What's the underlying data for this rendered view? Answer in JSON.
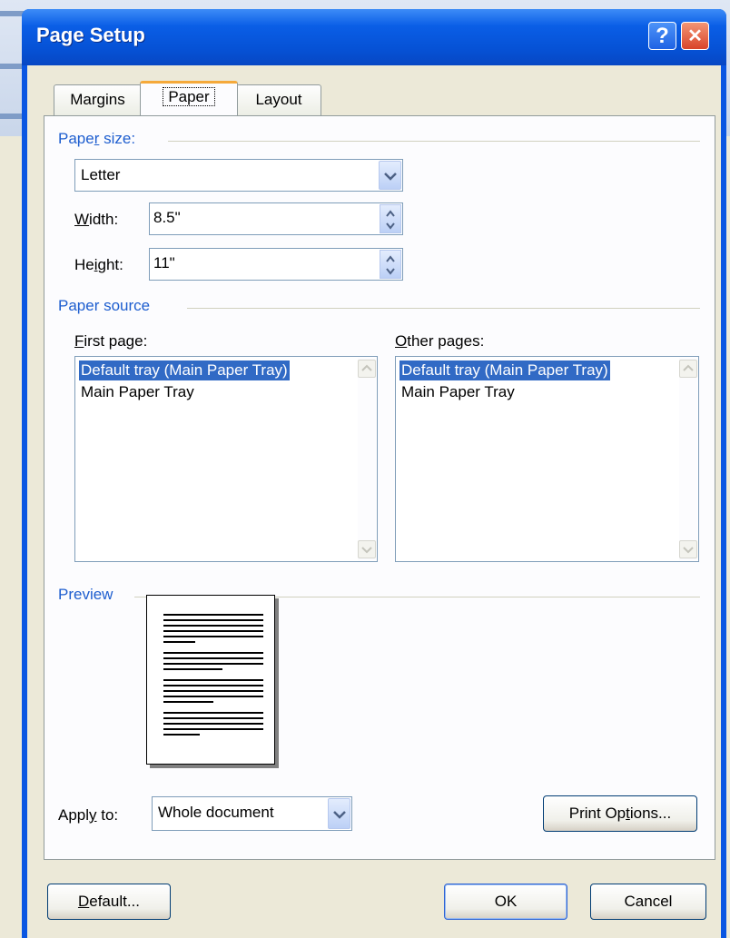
{
  "dialog": {
    "title": "Page Setup",
    "help_glyph": "?",
    "close_glyph": "✕"
  },
  "tabs": [
    {
      "label": "Margins",
      "active": false
    },
    {
      "label": "Paper",
      "active": true
    },
    {
      "label": "Layout",
      "active": false
    }
  ],
  "paper_size": {
    "group_label_pre": "Pape",
    "group_label_u": "r",
    "group_label_post": " size:",
    "selected": "Letter",
    "width_label_u": "W",
    "width_label_post": "idth:",
    "width_value": "8.5\"",
    "height_label_pre": "He",
    "height_label_u": "i",
    "height_label_post": "ght:",
    "height_value": "11\""
  },
  "paper_source": {
    "group_label": "Paper source",
    "first_page_label_u": "F",
    "first_page_label_post": "irst page:",
    "other_pages_label_u": "O",
    "other_pages_label_post": "ther pages:",
    "first_page_items": [
      "Default tray (Main Paper Tray)",
      "Main Paper Tray"
    ],
    "other_pages_items": [
      "Default tray (Main Paper Tray)",
      "Main Paper Tray"
    ]
  },
  "preview": {
    "group_label": "Preview"
  },
  "apply_to": {
    "label_pre": "Appl",
    "label_u": "y",
    "label_post": " to:",
    "value": "Whole document"
  },
  "buttons": {
    "print_options_pre": "Print Op",
    "print_options_u": "t",
    "print_options_post": "ions...",
    "default_u": "D",
    "default_post": "efault...",
    "ok": "OK",
    "cancel": "Cancel"
  },
  "colors": {
    "title_bar": "#0a56e2",
    "group_label": "#1e5ecf",
    "selection": "#316ac5",
    "active_tab_accent": "#f5a93a"
  }
}
